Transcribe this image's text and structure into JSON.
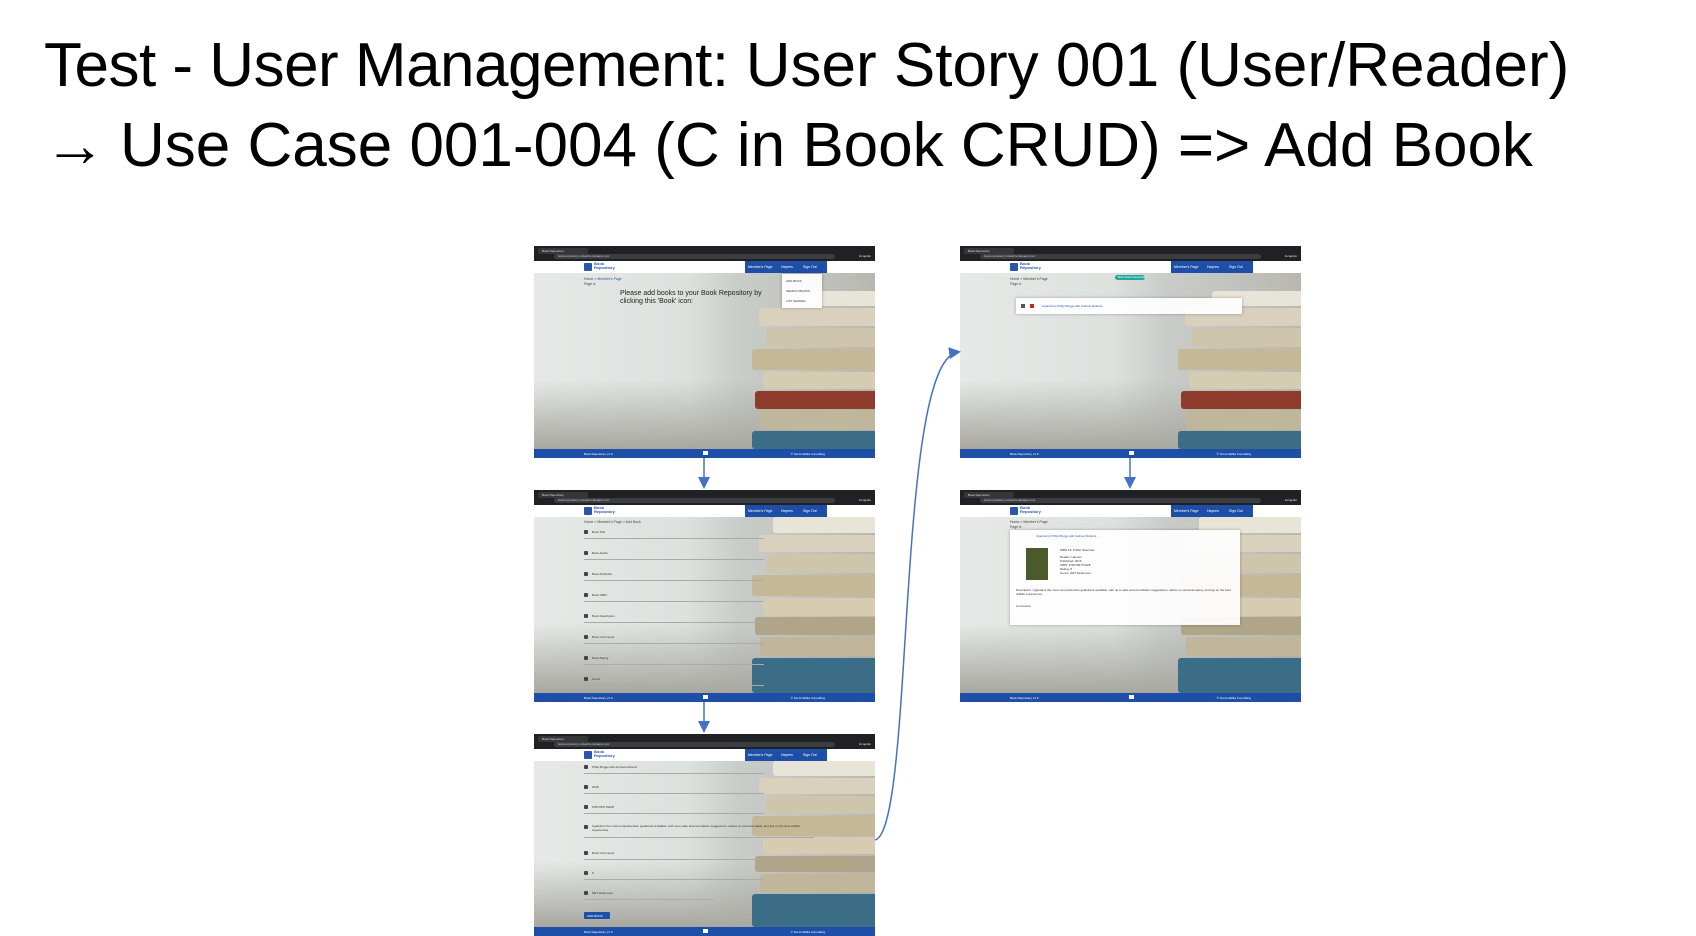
{
  "slide": {
    "title_bold": "Test - User Management:",
    "title_rest": " User Story 001 (User/Reader)",
    "subtitle_arrow": "→",
    "subtitle": "Use Case 001-004 (C in Book CRUD) => Add Book"
  },
  "browser": {
    "tab_title": "Book Repository",
    "url": "book-repository-virtual.herokuapp.com",
    "incognito": "Incognito"
  },
  "app": {
    "logo_text": "Book\nRepository",
    "nav": [
      "Member's Page",
      "Haynes",
      "Sign Out"
    ],
    "footer_left": "Book Repository v1.0",
    "footer_right": "© Scott Halfka Consulting"
  },
  "screens": {
    "s1": {
      "breadcrumb_home": "Home",
      "breadcrumb_page": "Member's Page",
      "page_label": "Page #:",
      "message_line1": "Please add books to your Book Repository by",
      "message_line2": "clicking this 'Book' icon:",
      "menu_items": [
        "ADD BOOK",
        "SEARCH BOOKS",
        "LIST SHARED"
      ]
    },
    "s2": {
      "breadcrumb": "Home > Member's Page > Add Book",
      "fields": [
        "Book Title",
        "Book Author",
        "Book Publisher",
        "Book ISBN",
        "Book Description",
        "Book Comments",
        "Book Rating",
        "Genre"
      ]
    },
    "s3": {
      "values": [
        "Philip Briggs with Andrew Roberts",
        "2016",
        "9781784770228",
        "Uganda is the most comprehensive guidebook available, with up-to-date accommodation suggestions, advice on personal safety, and tips on the best wildlife experiences.",
        "Book Comments",
        "5",
        "DRT Reference"
      ],
      "button": "ADD BOOK"
    },
    "s4": {
      "toast": "Book Added Successfully",
      "breadcrumb": "Home > Member's Page",
      "page_label": "Page #:",
      "book_line": "Uganda by Philip Briggs with Andrew Roberts"
    },
    "s5": {
      "breadcrumb": "Home > Member's Page",
      "page_label": "Page #:",
      "book_line": "Uganda by Philip Briggs with Andrew Roberts",
      "isbn_line": "ISBN-13: Public Searches",
      "details": [
        "Reader: Haynes",
        "Published: 2016",
        "ISBN: 9781784770228",
        "Rating: 5",
        "Genre: DRT Reference"
      ],
      "description": "Description: Uganda is the most comprehensive guidebook available, with up-to-date accommodation suggestions, advice on personal safety, and tips on the best wildlife experiences.",
      "comments": "Comments:"
    }
  },
  "colors": {
    "brand_blue": "#1e4fa8",
    "connector_blue": "#4472c4",
    "chrome_dark": "#202124"
  }
}
